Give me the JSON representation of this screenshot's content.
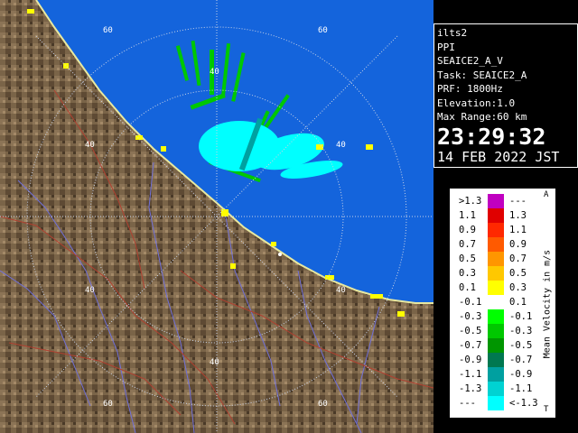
{
  "radar": {
    "rings": [
      "60",
      "40",
      "40",
      "40",
      "40",
      "40",
      "60"
    ],
    "colors": {
      "land": "#7a6448",
      "sea": "#1464dc",
      "grid": "#c8d2e6",
      "rivers": "#7070d8",
      "roads": "#b04030"
    }
  },
  "info": {
    "site": "ilts2",
    "mode": "PPI",
    "scan": "SEAICE2_A_V",
    "task": "Task: SEAICE2_A",
    "prf": "PRF: 1800Hz",
    "elevation": "Elevation:1.0",
    "range": "Max Range:60 km",
    "time": "23:29:32",
    "date": "14 FEB 2022 JST"
  },
  "legend": {
    "title": "Mean Velocity in m/s",
    "tick_top": "A",
    "tick_bottom": "T",
    "rows": [
      {
        "left": ">1.3",
        "right": "---",
        "color": "#c000c0"
      },
      {
        "left": "1.1",
        "right": "1.3",
        "color": "#e00000"
      },
      {
        "left": "0.9",
        "right": "1.1",
        "color": "#ff2800"
      },
      {
        "left": "0.7",
        "right": "0.9",
        "color": "#ff5a00"
      },
      {
        "left": "0.5",
        "right": "0.7",
        "color": "#ff9600"
      },
      {
        "left": "0.3",
        "right": "0.5",
        "color": "#ffc800"
      },
      {
        "left": "0.1",
        "right": "0.3",
        "color": "#ffff00"
      },
      {
        "left": "-0.1",
        "right": "0.1",
        "color": "#ffffff"
      },
      {
        "left": "-0.3",
        "right": "-0.1",
        "color": "#00ff00"
      },
      {
        "left": "-0.5",
        "right": "-0.3",
        "color": "#00c800"
      },
      {
        "left": "-0.7",
        "right": "-0.5",
        "color": "#009600"
      },
      {
        "left": "-0.9",
        "right": "-0.7",
        "color": "#007850"
      },
      {
        "left": "-1.1",
        "right": "-0.9",
        "color": "#00a0a0"
      },
      {
        "left": "-1.3",
        "right": "-1.1",
        "color": "#00d2d2"
      },
      {
        "left": "---",
        "right": "<-1.3",
        "color": "#00ffff"
      }
    ]
  }
}
